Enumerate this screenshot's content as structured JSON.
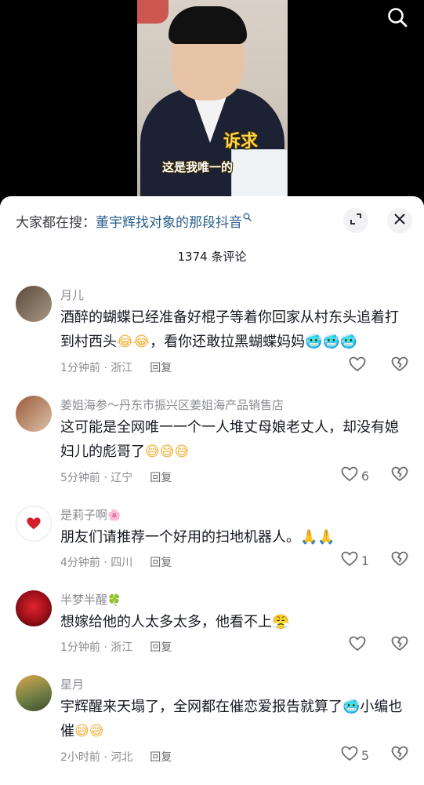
{
  "video": {
    "caption_top": "诉求",
    "caption_bottom": "这是我唯一的"
  },
  "search_bar": {
    "prefix": "大家都在搜：",
    "term": "董宇辉找对象的那段抖音"
  },
  "comment_count": "1374 条评论",
  "comments": [
    {
      "username": "月儿",
      "badge": "",
      "text": "酒醉的蝴蝶已经准备好棍子等着你回家从村东头追着打到村西头",
      "text2": "，看你还敢拉黑蝴蝶妈妈",
      "time": "1分钟前 · 浙江",
      "reply": "回复",
      "likes": ""
    },
    {
      "username": "姜姐海参～丹东市振兴区姜姐海产品销售店",
      "badge": "",
      "text": "这可能是全网唯一一个一人堆丈母娘老丈人，却没有媳妇儿的彪哥了",
      "text2": "",
      "time": "5分钟前 · 辽宁",
      "reply": "回复",
      "likes": "6"
    },
    {
      "username": "是莉子啊",
      "badge": "🌸",
      "text": "朋友们请推荐一个好用的扫地机器人。",
      "text2": "",
      "time": "4分钟前 · 四川",
      "reply": "回复",
      "likes": "1"
    },
    {
      "username": "半梦半醒",
      "badge": "🍀",
      "text": "想嫁给他的人太多太多，他看不上",
      "text2": "",
      "time": "1分钟前 · 浙江",
      "reply": "回复",
      "likes": ""
    },
    {
      "username": "星月",
      "badge": "",
      "text": "宇辉醒来天塌了，全网都在催恋爱报告就算了",
      "text2": "小编也催",
      "time": "2小时前 · 河北",
      "reply": "回复",
      "likes": "5"
    }
  ]
}
